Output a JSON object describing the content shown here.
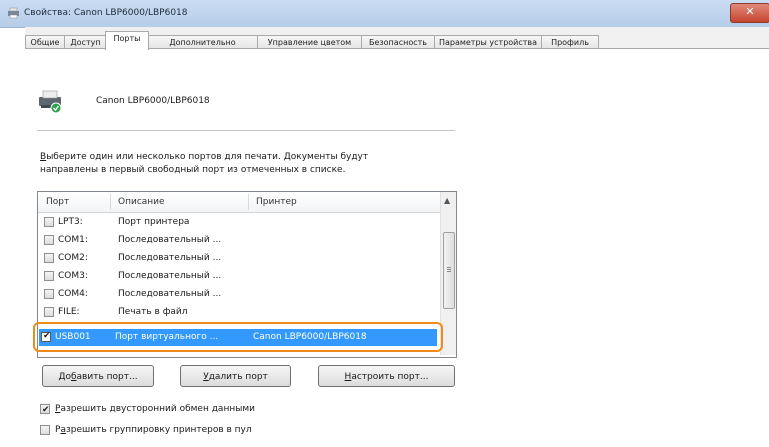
{
  "window": {
    "title": "Свойства: Canon LBP6000/LBP6018",
    "close_glyph": "✕"
  },
  "tabs": [
    {
      "label": "Общие"
    },
    {
      "label": "Доступ"
    },
    {
      "label": "Порты"
    },
    {
      "label": "Дополнительно"
    },
    {
      "label": "Управление цветом"
    },
    {
      "label": "Безопасность"
    },
    {
      "label": "Параметры устройства"
    },
    {
      "label": "Профиль"
    }
  ],
  "printer": {
    "name": "Canon LBP6000/LBP6018",
    "icon": "printer-icon"
  },
  "instructions": {
    "line1_access": "В",
    "line1_rest": "ыберите один или несколько портов для печати. Документы будут",
    "line2": "направлены в первый свободный порт из отмеченных в списке."
  },
  "ports_table": {
    "headers": [
      "Порт",
      "Описание",
      "Принтер"
    ],
    "scroll_up_glyph": "▲",
    "rows": [
      {
        "port": "LPT3:",
        "description": "Порт принтера",
        "printer": "",
        "checked": false
      },
      {
        "port": "COM1:",
        "description": "Последовательный ...",
        "printer": "",
        "checked": false
      },
      {
        "port": "COM2:",
        "description": "Последовательный ...",
        "printer": "",
        "checked": false
      },
      {
        "port": "COM3:",
        "description": "Последовательный ...",
        "printer": "",
        "checked": false
      },
      {
        "port": "COM4:",
        "description": "Последовательный ...",
        "printer": "",
        "checked": false
      },
      {
        "port": "FILE:",
        "description": "Печать в файл",
        "printer": "",
        "checked": false
      }
    ],
    "selected_row": {
      "port": "USB001",
      "description": "Порт виртуального ...",
      "printer": "Canon LBP6000/LBP6018",
      "checked": true,
      "check_glyph": "✔"
    }
  },
  "buttons": {
    "add_port_pre": "До",
    "add_port_access": "б",
    "add_port_post": "авить порт...",
    "delete_port_access": "У",
    "delete_port_rest": "далить порт",
    "configure_port_access": "Н",
    "configure_port_rest": "астроить порт..."
  },
  "options": {
    "bidirectional_access": "Р",
    "bidirectional_rest": "азрешить двусторонний обмен данными",
    "bidirectional_checked": true,
    "pooling_pre": "Р",
    "pooling_access": "а",
    "pooling_rest": "зрешить группировку принтеров в пул",
    "pooling_checked": false,
    "check_glyph": "✔"
  },
  "colors": {
    "selection": "#3399ff",
    "highlight_outline": "#f08a1b",
    "close_button": "#c6452f"
  }
}
